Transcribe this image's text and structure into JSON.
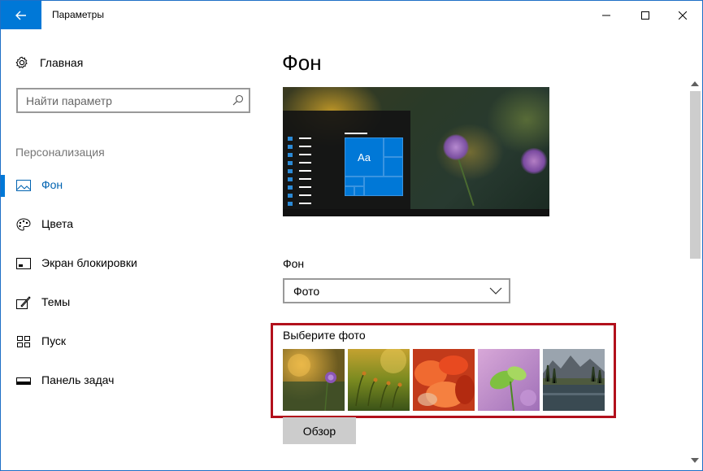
{
  "window": {
    "title": "Параметры"
  },
  "sidebar": {
    "home_label": "Главная",
    "search_placeholder": "Найти параметр",
    "section_title": "Персонализация",
    "items": [
      {
        "label": "Фон",
        "icon": "picture-icon",
        "active": true
      },
      {
        "label": "Цвета",
        "icon": "palette-icon",
        "active": false
      },
      {
        "label": "Экран блокировки",
        "icon": "lock-screen-icon",
        "active": false
      },
      {
        "label": "Темы",
        "icon": "themes-icon",
        "active": false
      },
      {
        "label": "Пуск",
        "icon": "start-icon",
        "active": false
      },
      {
        "label": "Панель задач",
        "icon": "taskbar-icon",
        "active": false
      }
    ]
  },
  "main": {
    "title": "Фон",
    "preview_tile_label": "Aa",
    "background_label": "Фон",
    "background_value": "Фото",
    "choose_photo_label": "Выберите фото",
    "browse_label": "Обзор",
    "thumbnails": [
      {
        "name": "purple-flower-thumbnail"
      },
      {
        "name": "moss-thumbnail"
      },
      {
        "name": "red-flower-thumbnail"
      },
      {
        "name": "green-leaves-thumbnail"
      },
      {
        "name": "lake-mountains-thumbnail"
      }
    ]
  },
  "colors": {
    "accent": "#0078d7",
    "highlight_box": "#b2101c"
  }
}
